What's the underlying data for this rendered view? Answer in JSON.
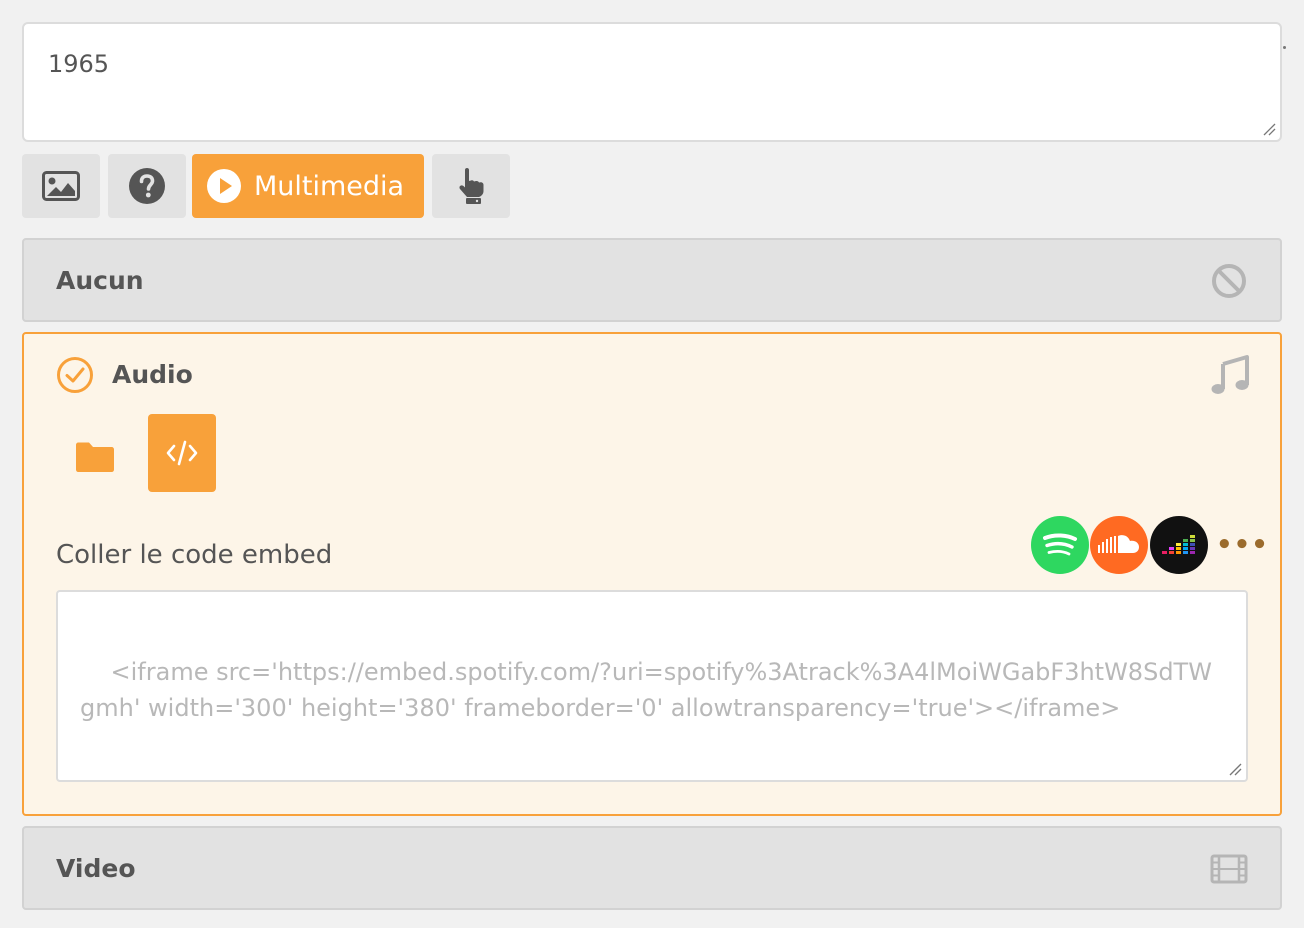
{
  "top_field": {
    "value": "1965"
  },
  "toolbar": {
    "image_icon": "image-icon",
    "help_icon": "question-circle-icon",
    "multimedia_label": "Multimedia",
    "multimedia_icon": "play-circle-icon",
    "touch_icon": "hand-pointer-icon",
    "accent_color": "#f8a13a"
  },
  "options": {
    "none": {
      "label": "Aucun",
      "icon": "ban-icon"
    },
    "audio": {
      "label": "Audio",
      "icon": "music-note-icon",
      "selected": true,
      "modes": [
        {
          "name": "folder-icon",
          "active": false
        },
        {
          "name": "code-icon",
          "active": true
        }
      ],
      "embed_label": "Coller le code embed",
      "embed_placeholder": "<iframe src='https://embed.spotify.com/?uri=spotify%3Atrack%3A4lMoiWGabF3htW8SdTWgmh' width='300' height='380' frameborder='0' allowtransparency='true'></iframe>",
      "providers": [
        {
          "name": "spotify",
          "color": "#2ed760"
        },
        {
          "name": "soundcloud",
          "color": "#ff6a22"
        },
        {
          "name": "deezer",
          "color": "#111111"
        }
      ],
      "more_label": "•••"
    },
    "video": {
      "label": "Video",
      "icon": "film-icon"
    }
  }
}
